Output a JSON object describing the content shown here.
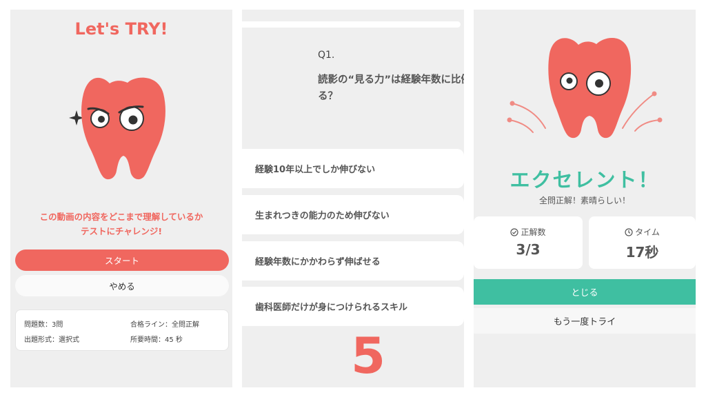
{
  "intro": {
    "title": "Let's TRY!",
    "message_line1": "この動画の内容をどこまで理解しているか",
    "message_line2": "テストにチャレンジ!",
    "start_label": "スタート",
    "quit_label": "やめる",
    "info": {
      "question_count": "問題数：3問",
      "pass_line": "合格ライン：全問正解",
      "format": "出題形式：選択式",
      "time_required": "所要時間：45 秒"
    }
  },
  "quiz": {
    "progress": 1.0,
    "question_number": "Q1.",
    "question_text": "読影の“見る力”は経験年数に比例する？",
    "choices": [
      "経験10年以上でしか伸びない",
      "生まれつきの能力のため伸びない",
      "経験年数にかかわらず伸ばせる",
      "歯科医師だけが身につけられるスキル"
    ],
    "countdown": "5"
  },
  "result": {
    "title": "エクセレント！",
    "subtitle": "全問正解！素晴らしい！",
    "correct_label": "正解数",
    "correct_value": "3/3",
    "time_label": "タイム",
    "time_value": "17秒",
    "close_label": "とじる",
    "retry_label": "もう一度トライ"
  },
  "colors": {
    "accent_red": "#f0675f",
    "accent_green": "#3fbfa1",
    "panel_bg": "#efefef"
  },
  "icons": [
    "sparkle-icon",
    "check-circle-icon",
    "clock-icon"
  ]
}
